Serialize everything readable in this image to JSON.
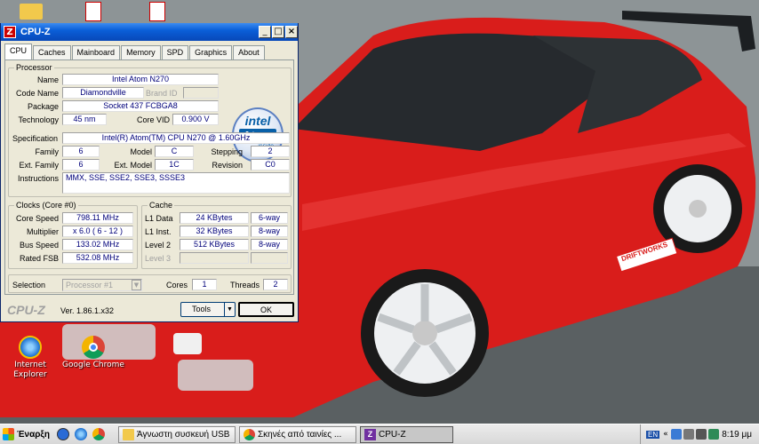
{
  "window": {
    "title": "CPU-Z",
    "tabs": [
      "CPU",
      "Caches",
      "Mainboard",
      "Memory",
      "SPD",
      "Graphics",
      "About"
    ],
    "active_tab": "CPU"
  },
  "processor": {
    "group_label": "Processor",
    "name_label": "Name",
    "name": "Intel Atom N270",
    "codename_label": "Code Name",
    "codename": "Diamondville",
    "brandid_label": "Brand ID",
    "brandid": "",
    "package_label": "Package",
    "package": "Socket 437 FCBGA8",
    "technology_label": "Technology",
    "technology": "45 nm",
    "corevid_label": "Core VID",
    "corevid": "0.900 V",
    "specification_label": "Specification",
    "specification": "Intel(R) Atom(TM) CPU N270   @ 1.60GHz",
    "family_label": "Family",
    "family": "6",
    "model_label": "Model",
    "model": "C",
    "stepping_label": "Stepping",
    "stepping": "2",
    "extfamily_label": "Ext. Family",
    "extfamily": "6",
    "extmodel_label": "Ext. Model",
    "extmodel": "1C",
    "revision_label": "Revision",
    "revision": "C0",
    "instructions_label": "Instructions",
    "instructions": "MMX, SSE, SSE2, SSE3, SSSE3"
  },
  "logo": {
    "line1": "intel",
    "line2": "Atom",
    "line3": "inside"
  },
  "clocks": {
    "group_label": "Clocks (Core #0)",
    "corespeed_label": "Core Speed",
    "corespeed": "798.11 MHz",
    "multiplier_label": "Multiplier",
    "multiplier": "x 6.0 ( 6 - 12 )",
    "busspeed_label": "Bus Speed",
    "busspeed": "133.02 MHz",
    "ratedfsb_label": "Rated FSB",
    "ratedfsb": "532.08 MHz"
  },
  "cache": {
    "group_label": "Cache",
    "l1data_label": "L1 Data",
    "l1data": "24 KBytes",
    "l1data_way": "6-way",
    "l1inst_label": "L1 Inst.",
    "l1inst": "32 KBytes",
    "l1inst_way": "8-way",
    "level2_label": "Level 2",
    "level2": "512 KBytes",
    "level2_way": "8-way",
    "level3_label": "Level 3",
    "level3": "",
    "level3_way": ""
  },
  "selection": {
    "selection_label": "Selection",
    "processor": "Processor #1",
    "cores_label": "Cores",
    "cores": "1",
    "threads_label": "Threads",
    "threads": "2"
  },
  "footer": {
    "brand": "CPU-Z",
    "version": "Ver. 1.86.1.x32",
    "tools_label": "Tools",
    "ok_label": "OK"
  },
  "desktop": {
    "icons": [
      {
        "label": "Internet\nExplorer"
      },
      {
        "label": "Google Chrome"
      }
    ],
    "decal_text": "DRIFTWORKS"
  },
  "taskbar": {
    "start_label": "Έναρξη",
    "tasks": [
      "Άγνωστη συσκευή USB",
      "Σκηνές από ταινίες ...",
      "CPU-Z"
    ],
    "tray_lang": "EN",
    "clock": "8:19 μμ"
  },
  "colors": {
    "titlebar": "#0a5fd8",
    "car_red": "#e0201e",
    "value_text": "#00007a"
  }
}
